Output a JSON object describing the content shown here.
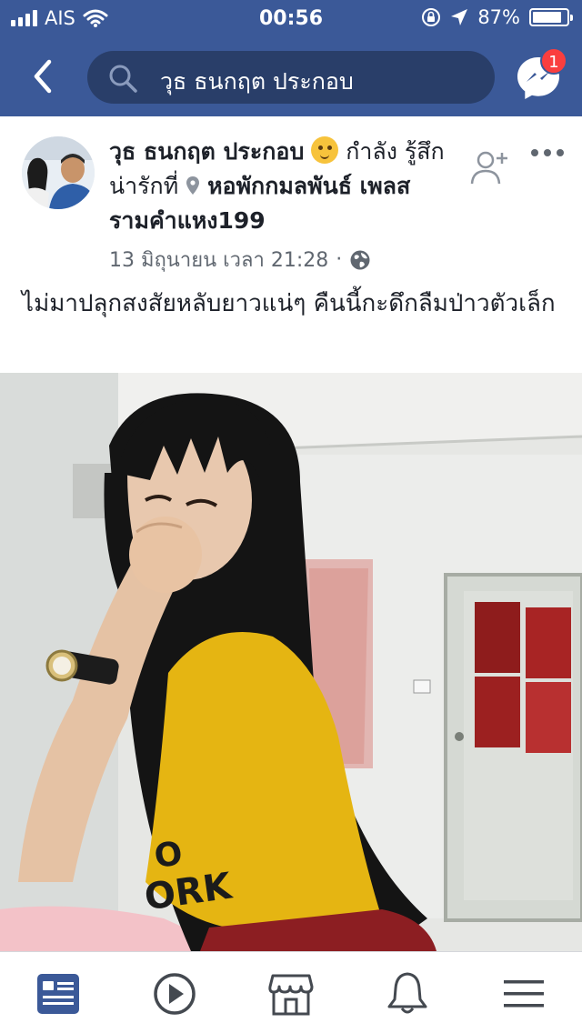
{
  "status_bar": {
    "carrier": "AIS",
    "time": "00:56",
    "battery": "87%",
    "battery_level": 0.87
  },
  "nav": {
    "search_text": "วุธ ธนกฤต ประกอบ",
    "messenger_badge": "1"
  },
  "post": {
    "author": "วุธ ธนกฤต ประกอบ",
    "feeling": "กำลัง รู้สึกน่ารักที่",
    "location": "หอพักกมลพันธ์ เพลส รามคำแหง199",
    "timestamp": "13 มิถุนายน เวลา 21:28",
    "separator": "·",
    "message": "ไม่มาปลุกสงสัยหลับยาวแน่ๆ คืนนี้กะดึกลืมป่าวตัวเล็ก"
  },
  "photo": {
    "shirt_text_line1": "O",
    "shirt_text_line2": "ORK"
  },
  "colors": {
    "header": "#3b5998",
    "search_bg": "#293e69",
    "badge": "#fa3e3e",
    "tab_active": "#3b5998",
    "tab_inactive": "#444950"
  },
  "tabs": [
    {
      "icon": "news-feed-icon",
      "active": true
    },
    {
      "icon": "watch-video-icon",
      "active": false
    },
    {
      "icon": "marketplace-icon",
      "active": false
    },
    {
      "icon": "notifications-bell-icon",
      "active": false
    },
    {
      "icon": "menu-hamburger-icon",
      "active": false
    }
  ]
}
